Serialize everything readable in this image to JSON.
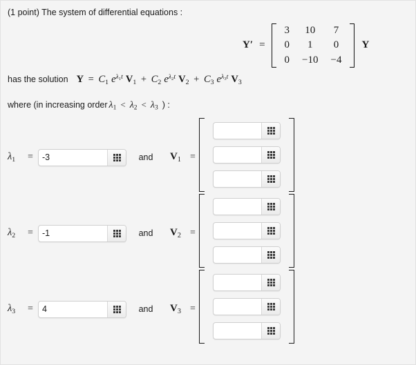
{
  "problem": {
    "points_label": "(1 point) The system of differential equations :",
    "equation": {
      "lhs": "Y′",
      "equals": "=",
      "matrix": [
        [
          "3",
          "10",
          "7"
        ],
        [
          "0",
          "1",
          "0"
        ],
        [
          "0",
          "−10",
          "−4"
        ]
      ],
      "rhs": "Y"
    },
    "solution_lead": "has the solution",
    "solution_lhs": "Y",
    "solution_equals": "=",
    "solution_terms": [
      {
        "coef": "C",
        "coef_sub": "1",
        "exp_base": "e",
        "exp_lambda": "λ",
        "exp_lambda_sub": "1",
        "exp_var": "t",
        "vec": "V",
        "vec_sub": "1"
      },
      {
        "coef": "C",
        "coef_sub": "2",
        "exp_base": "e",
        "exp_lambda": "λ",
        "exp_lambda_sub": "2",
        "exp_var": "t",
        "vec": "V",
        "vec_sub": "2"
      },
      {
        "coef": "C",
        "coef_sub": "3",
        "exp_base": "e",
        "exp_lambda": "λ",
        "exp_lambda_sub": "3",
        "exp_var": "t",
        "vec": "V",
        "vec_sub": "3"
      }
    ],
    "solution_op": "+",
    "where": {
      "prefix": "where (in increasing order",
      "lambda": "λ",
      "subs": [
        "1",
        "2",
        "3"
      ],
      "relation": "<",
      "suffix": ") :"
    }
  },
  "answers": {
    "and_label": "and",
    "equals": "=",
    "lambda_symbol": "λ",
    "vector_symbol": "V",
    "rows": [
      {
        "index": "1",
        "lambda_value": "-3",
        "lambda_placeholder": "",
        "vector_values": [
          "",
          "",
          ""
        ],
        "vector_placeholder": ""
      },
      {
        "index": "2",
        "lambda_value": "-1",
        "lambda_placeholder": "",
        "vector_values": [
          "",
          "",
          ""
        ],
        "vector_placeholder": ""
      },
      {
        "index": "3",
        "lambda_value": "4",
        "lambda_placeholder": "",
        "vector_values": [
          "",
          "",
          ""
        ],
        "vector_placeholder": ""
      }
    ]
  },
  "icons": {
    "keypad": "keypad-grid-icon"
  },
  "colors": {
    "page_background": "#f4f4f4",
    "input_background": "#ffffff",
    "input_border": "#cfcfcf",
    "text": "#1a1a1a"
  }
}
